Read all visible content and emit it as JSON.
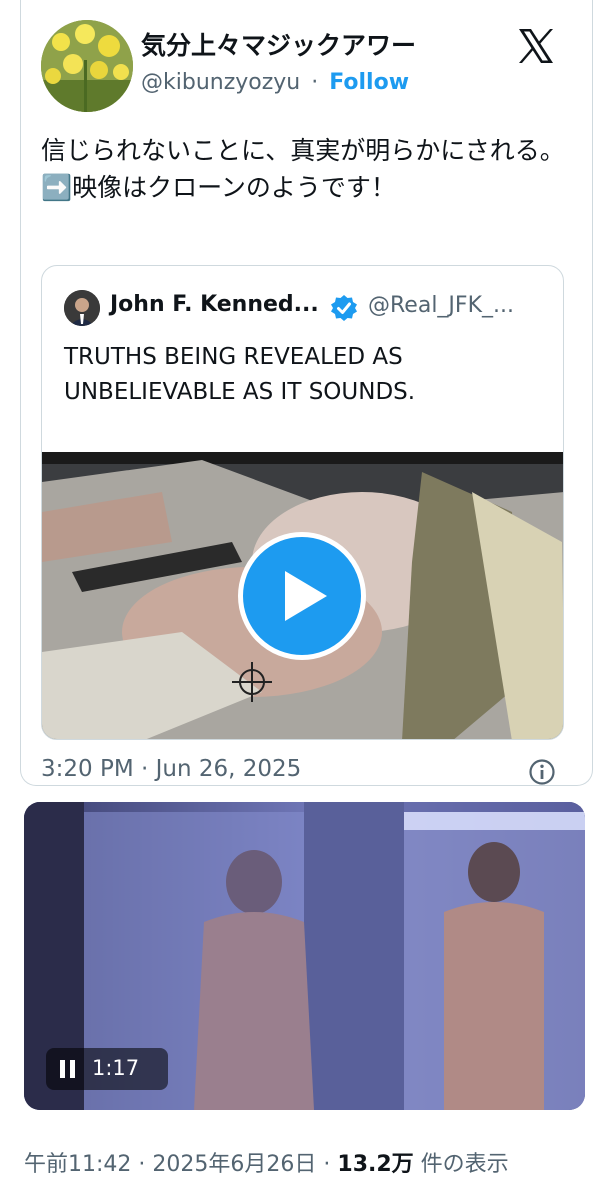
{
  "post": {
    "display_name": "気分上々マジックアワー",
    "handle": "@kibunzyozyu",
    "separator": "·",
    "follow_label": "Follow",
    "text_line1": "信じられないことに、真実が明らかにされる。",
    "text_line2_emoji": "➡️",
    "text_line2": "映像はクローンのようです！",
    "timestamp": "3:20 PM · Jun 26, 2025",
    "icons": {
      "platform": "x-logo-icon",
      "info": "info-icon"
    }
  },
  "quoted_post": {
    "display_name": "John F. Kenned...",
    "handle": "@Real_JFK_...",
    "verified": true,
    "text": "TRUTHS BEING REVEALED AS UNBELIEVABLE AS IT SOUNDS.",
    "media": {
      "type": "video",
      "play_icon": "play-icon"
    }
  },
  "second_video": {
    "state": "playing",
    "control_icon": "pause-icon",
    "time": "1:17"
  },
  "footer_meta": {
    "time": "午前11:42",
    "sep1": "·",
    "date": "2025年6月26日",
    "sep2": "·",
    "views": "13.2万",
    "views_label": "件の表示"
  },
  "colors": {
    "accent": "#1d9bf0",
    "text": "#0f1419",
    "secondary_text": "#536471",
    "border": "#cfd9de"
  }
}
